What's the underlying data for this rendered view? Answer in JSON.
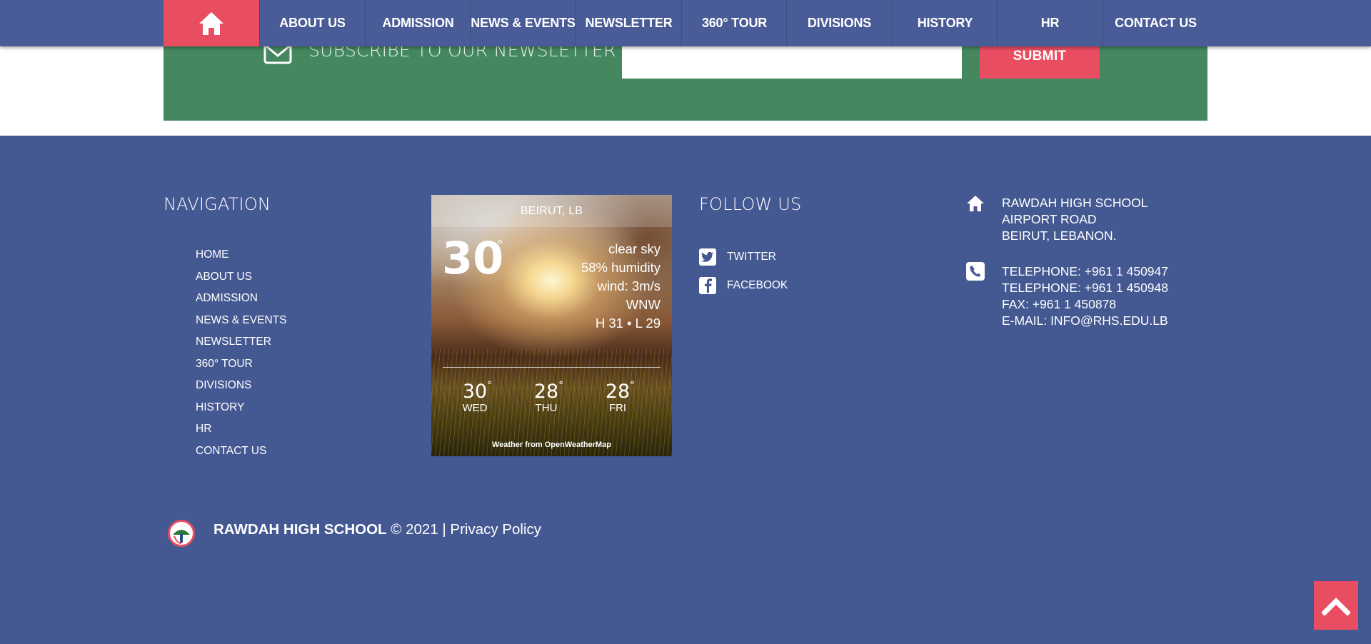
{
  "nav": {
    "home_icon": "home-icon",
    "items": [
      "ABOUT US",
      "ADMISSION",
      "NEWS & EVENTS",
      "NEWSLETTER",
      "360° TOUR",
      "DIVISIONS",
      "HISTORY",
      "HR",
      "CONTACT US"
    ]
  },
  "newsletter": {
    "icon": "envelope-icon",
    "title": "SUBSCRIBE TO OUR NEWSLETTER",
    "email_value": "",
    "submit_label": "SUBMIT"
  },
  "navigation": {
    "title": "NAVIGATION",
    "links": [
      "HOME",
      "ABOUT US",
      "ADMISSION",
      "NEWS & EVENTS",
      "NEWSLETTER",
      "360° TOUR",
      "DIVISIONS",
      "HISTORY",
      "HR",
      "CONTACT US"
    ]
  },
  "weather": {
    "location": "BEIRUT, LB",
    "temp": "30",
    "deg": "°",
    "description": "clear sky",
    "humidity": "58% humidity",
    "wind": "wind: 3m/s",
    "direction": "WNW",
    "high_low": "H 31 • L 29",
    "forecast": [
      {
        "temp": "30",
        "day": "WED"
      },
      {
        "temp": "28",
        "day": "THU"
      },
      {
        "temp": "28",
        "day": "FRI"
      }
    ],
    "credit": "Weather from OpenWeatherMap"
  },
  "follow": {
    "title": "FOLLOW US",
    "items": [
      {
        "icon": "twitter-icon",
        "label": "TWITTER"
      },
      {
        "icon": "facebook-icon",
        "label": "FACEBOOK"
      }
    ]
  },
  "contact": {
    "address_icon": "home-icon",
    "address": [
      "RAWDAH HIGH SCHOOL",
      "AIRPORT ROAD",
      "BEIRUT, LEBANON."
    ],
    "phone_icon": "phone-icon",
    "phones": [
      "TELEPHONE: +961 1 450947",
      "TELEPHONE: +961 1 450948",
      "FAX: +961 1 450878",
      "E-MAIL: INFO@RHS.EDU.LB"
    ]
  },
  "footer": {
    "logo": "school-logo",
    "school_name": "RAWDAH HIGH SCHOOL",
    "copyright": " © 2021 | ",
    "privacy": "Privacy Policy"
  },
  "back_to_top_icon": "chevron-up-icon",
  "colors": {
    "navbar": "#4a5c98",
    "accent": "#e84d62",
    "footer_bg": "#445892",
    "newsletter_bg": "#458860"
  }
}
